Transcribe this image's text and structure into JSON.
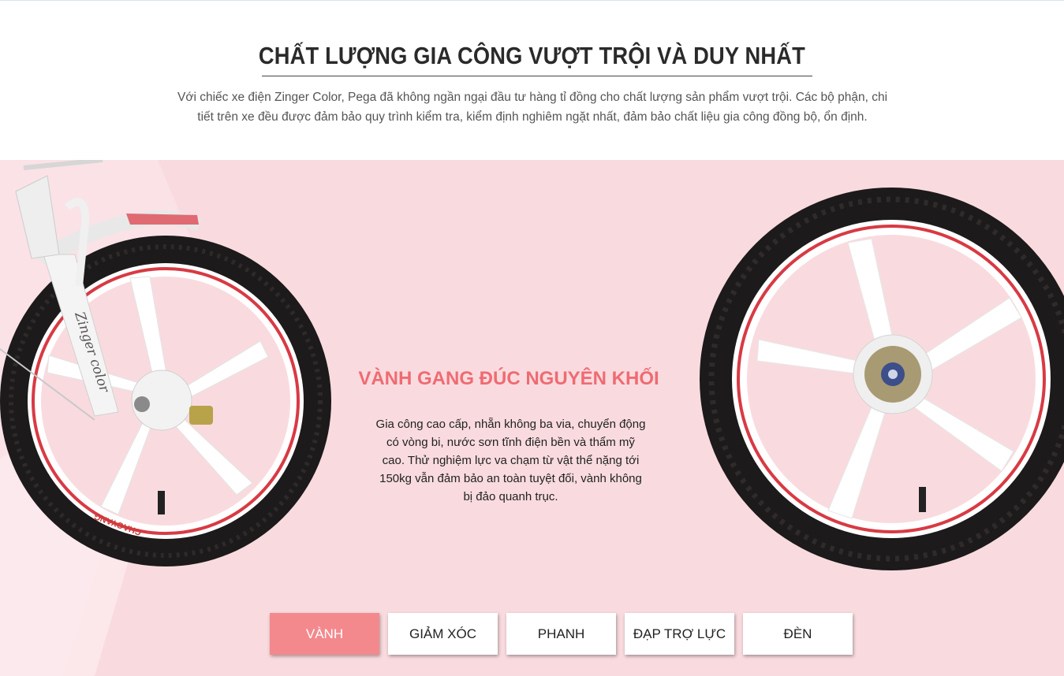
{
  "header": {
    "title": "CHẤT LƯỢNG GIA CÔNG VƯỢT TRỘI VÀ DUY NHẤT",
    "intro_line1": "Với chiếc xe điện Zinger Color, Pega đã không ngần ngại đầu tư hàng tỉ đồng cho chất lượng sản phẩm vượt trội. Các bộ phận, chi",
    "intro_line2": "tiết trên xe đều được đảm bảo quy trình kiểm tra, kiểm định nghiêm ngặt nhất, đảm bảo chất liệu gia công đồng bộ, ổn định."
  },
  "feature": {
    "title": "VÀNH GANG ĐÚC NGUYÊN KHỐI",
    "description": "Gia công cao cấp, nhẵn không ba via, chuyển động có vòng bi, nước sơn tĩnh điện bền và thẩm mỹ cao. Thử nghiệm lực va chạm từ vật thể nặng tới 150kg vẫn đảm bảo an toàn tuyệt đối, vành không bị đảo quanh trục."
  },
  "product_images": {
    "fork_text": "Zinger color",
    "tire_brand": "CHAOYANG"
  },
  "tabs": [
    {
      "label": "VÀNH",
      "active": true
    },
    {
      "label": "GIẢM XÓC",
      "active": false
    },
    {
      "label": "PHANH",
      "active": false
    },
    {
      "label": "ĐẠP TRỢ LỰC",
      "active": false
    },
    {
      "label": "ĐÈN",
      "active": false
    }
  ],
  "colors": {
    "accent": "#f3898d",
    "feature_title": "#ef6b72",
    "stage_background": "#f9dbdf"
  }
}
